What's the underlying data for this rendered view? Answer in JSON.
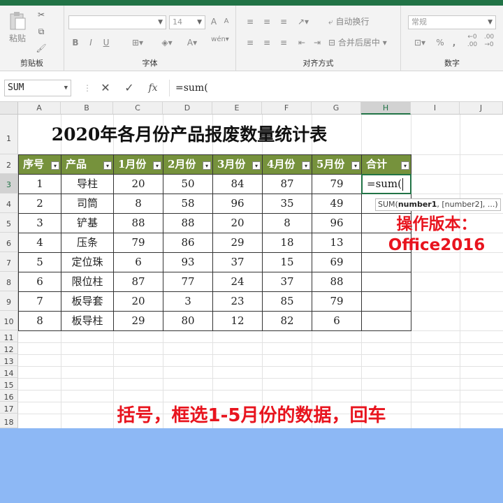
{
  "ribbon": {
    "clipboard": {
      "paste_label": "粘贴",
      "group_label": "剪贴板"
    },
    "font": {
      "size_value": "14",
      "bold": "B",
      "italic": "I",
      "underline": "U",
      "group_label": "字体"
    },
    "alignment": {
      "wrap_label": "自动换行",
      "merge_label": "合并后居中",
      "group_label": "对齐方式"
    },
    "number": {
      "format_value": "常规",
      "group_label": "数字",
      "percent": "%",
      "comma": ","
    }
  },
  "formula_bar": {
    "name_box": "SUM",
    "cancel": "✕",
    "enter": "✓",
    "fx": "fx",
    "content": "=sum("
  },
  "columns": [
    "A",
    "B",
    "C",
    "D",
    "E",
    "F",
    "G",
    "H",
    "I",
    "J"
  ],
  "rows": [
    "1",
    "2",
    "3",
    "4",
    "5",
    "6",
    "7",
    "8",
    "9",
    "10",
    "11",
    "12",
    "13",
    "14",
    "15",
    "16",
    "17",
    "18"
  ],
  "sheet": {
    "title": "2020年各月份产品报废数量统计表",
    "headers": [
      "序号",
      "产品",
      "1月份",
      "2月份",
      "3月份",
      "4月份",
      "5月份",
      "合计"
    ],
    "data": [
      [
        "1",
        "导柱",
        "20",
        "50",
        "84",
        "87",
        "79"
      ],
      [
        "2",
        "司筒",
        "8",
        "58",
        "96",
        "35",
        "49"
      ],
      [
        "3",
        "铲基",
        "88",
        "88",
        "20",
        "8",
        "96"
      ],
      [
        "4",
        "压条",
        "79",
        "86",
        "29",
        "18",
        "13"
      ],
      [
        "5",
        "定位珠",
        "6",
        "93",
        "37",
        "15",
        "69"
      ],
      [
        "6",
        "限位柱",
        "87",
        "77",
        "24",
        "37",
        "88"
      ],
      [
        "7",
        "板导套",
        "20",
        "3",
        "23",
        "85",
        "79"
      ],
      [
        "8",
        "板导柱",
        "29",
        "80",
        "12",
        "82",
        "6"
      ]
    ],
    "active_cell_text": "=sum(",
    "tooltip_func": "SUM(",
    "tooltip_arg1": "number1",
    "tooltip_rest": ", [number2], ...)"
  },
  "overlay": {
    "version_line1": "操作版本：",
    "version_line2": "Office2016",
    "caption": "括号，框选1-5月份的数据，回车"
  },
  "colors": {
    "excel_green": "#217346",
    "header_fill": "#76923c",
    "annotation_red": "#e8141e",
    "footer_blue": "#8db8f5"
  }
}
